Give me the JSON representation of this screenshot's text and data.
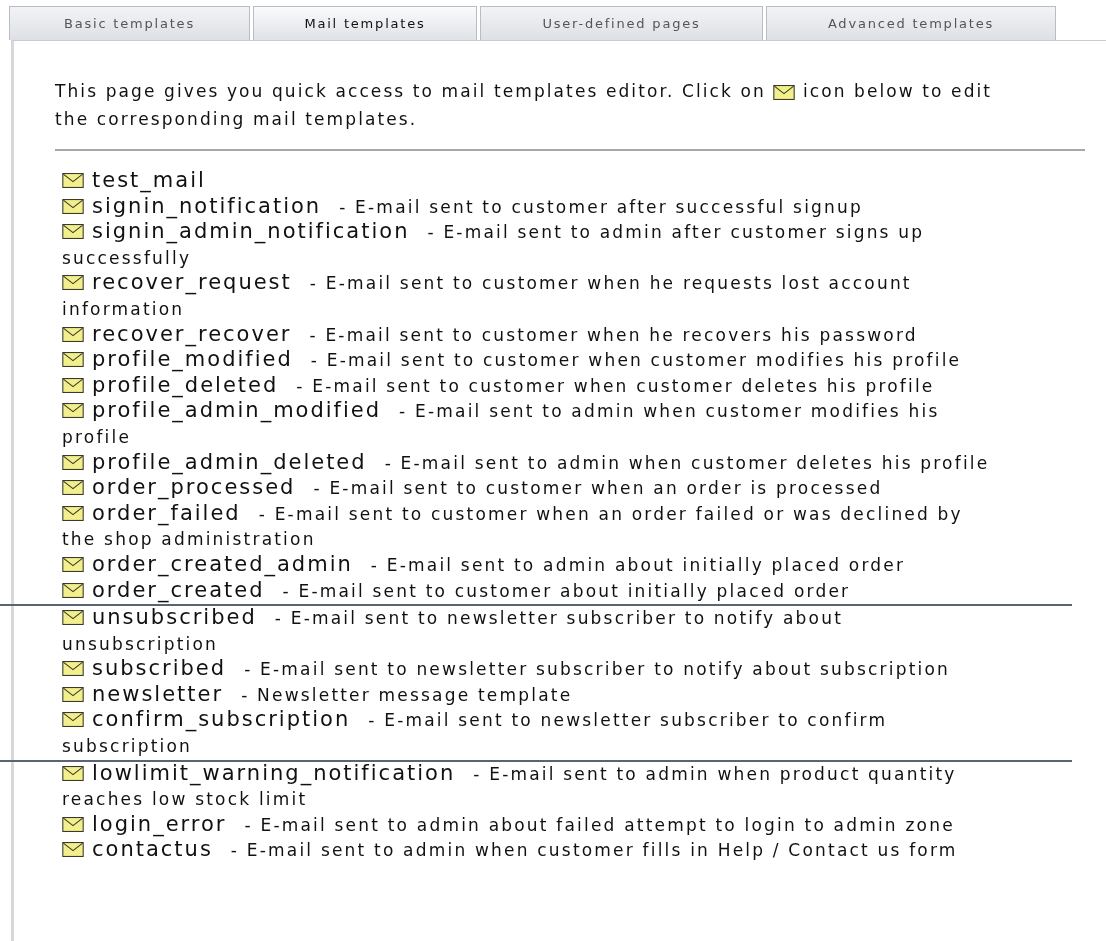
{
  "tabs": [
    {
      "label": "Basic templates",
      "selected": false
    },
    {
      "label": "Mail templates",
      "selected": true
    },
    {
      "label": "User-defined pages",
      "selected": false
    },
    {
      "label": "Advanced templates",
      "selected": false
    }
  ],
  "intro": {
    "before_icon": "This page gives you quick access to mail templates editor. Click on",
    "after_icon": "icon below to edit the corresponding mail templates."
  },
  "templates": [
    {
      "name": "test_mail",
      "divider_before": false
    },
    {
      "name": "signin_notification",
      "description": "- E-mail sent to customer after successful signup",
      "divider_before": false
    },
    {
      "name": "signin_admin_notification",
      "description": "- E-mail sent to admin after customer signs up",
      "continuation": "successfully",
      "divider_before": false
    },
    {
      "name": "recover_request",
      "description": "- E-mail sent to customer when he requests lost account",
      "continuation": "information",
      "divider_before": false
    },
    {
      "name": "recover_recover",
      "description": "- E-mail sent to customer when he recovers his password",
      "divider_before": false
    },
    {
      "name": "profile_modified",
      "description": "- E-mail sent to customer when customer modifies his profile",
      "divider_before": false
    },
    {
      "name": "profile_deleted",
      "description": "- E-mail sent to customer when customer deletes his profile",
      "divider_before": false
    },
    {
      "name": "profile_admin_modified",
      "description": "- E-mail sent to admin when customer modifies his",
      "continuation": "profile",
      "divider_before": false
    },
    {
      "name": "profile_admin_deleted",
      "description": "- E-mail sent to admin when customer deletes his profile",
      "divider_before": false
    },
    {
      "name": "order_processed",
      "description": "- E-mail sent to customer when an order is processed",
      "divider_before": false
    },
    {
      "name": "order_failed",
      "description": "- E-mail sent to customer when an order failed or was declined by",
      "continuation": "the shop administration",
      "divider_before": false
    },
    {
      "name": "order_created_admin",
      "description": "- E-mail sent to admin about initially placed order",
      "divider_before": false
    },
    {
      "name": "order_created",
      "description": "- E-mail sent to customer about initially placed order",
      "divider_before": false
    },
    {
      "name": "unsubscribed",
      "description": "- E-mail sent to newsletter subscriber to notify about",
      "continuation": "unsubscription",
      "divider_before": true
    },
    {
      "name": "subscribed",
      "description": "- E-mail sent to newsletter subscriber to notify about subscription",
      "divider_before": false
    },
    {
      "name": "newsletter",
      "description": "- Newsletter message template",
      "divider_before": false
    },
    {
      "name": "confirm_subscription",
      "description": "- E-mail sent to newsletter subscriber to confirm",
      "continuation": "subscription",
      "divider_before": false
    },
    {
      "name": "lowlimit_warning_notification",
      "description": "- E-mail sent to admin when product quantity",
      "continuation": "reaches low stock limit",
      "divider_before": true
    },
    {
      "name": "login_error",
      "description": "- E-mail sent to admin about failed attempt to login to admin zone",
      "divider_before": false
    },
    {
      "name": "contactus",
      "description": "- E-mail sent to admin when customer fills in Help / Contact us form",
      "divider_before": false
    }
  ]
}
